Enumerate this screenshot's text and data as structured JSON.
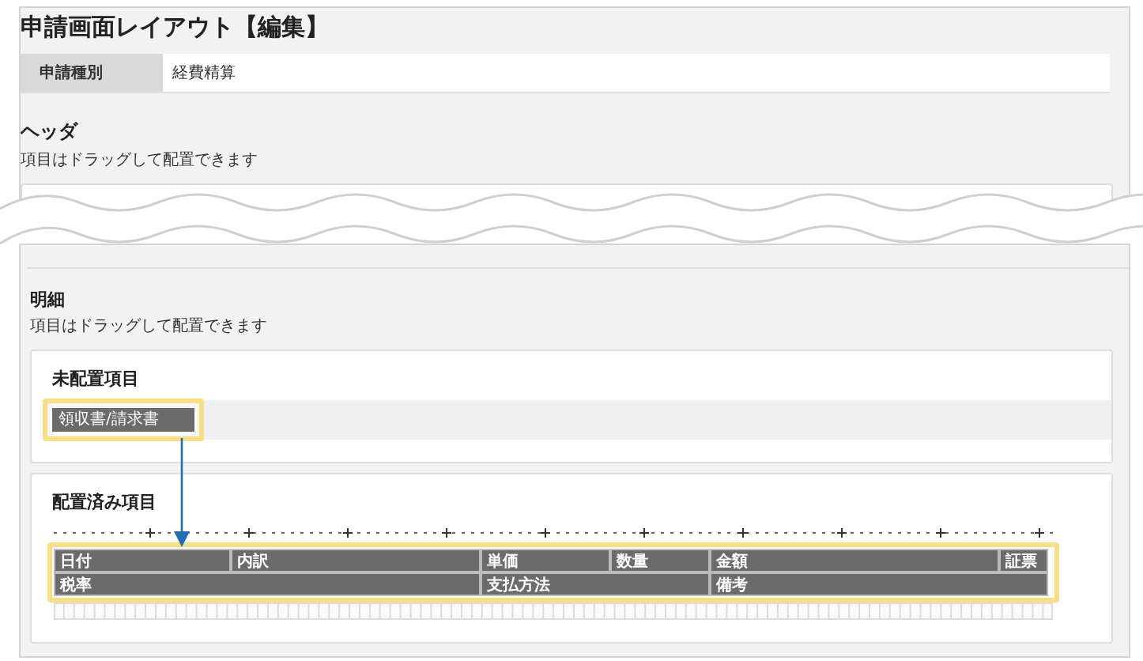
{
  "title": "申請画面レイアウト【編集】",
  "application_type": {
    "label": "申請種別",
    "value": "経費精算"
  },
  "header_section": {
    "heading": "ヘッダ",
    "hint": "項目はドラッグして配置できます"
  },
  "detail_section": {
    "heading": "明細",
    "hint": "項目はドラッグして配置できます",
    "unplaced": {
      "heading": "未配置項目",
      "items": [
        {
          "label": "領収書/請求書",
          "selected": true
        }
      ]
    },
    "placed": {
      "heading": "配置済み項目",
      "selected": true,
      "field_lines": [
        {
          "fields": [
            {
              "label": "日付"
            },
            {
              "label": "内訳"
            },
            {
              "label": "単価"
            },
            {
              "label": "数量"
            },
            {
              "label": "金額"
            },
            {
              "label": "証票"
            }
          ]
        },
        {
          "fields": [
            {
              "label": "税率"
            },
            {
              "label": "支払方法"
            },
            {
              "label": "備考"
            }
          ]
        }
      ]
    }
  }
}
